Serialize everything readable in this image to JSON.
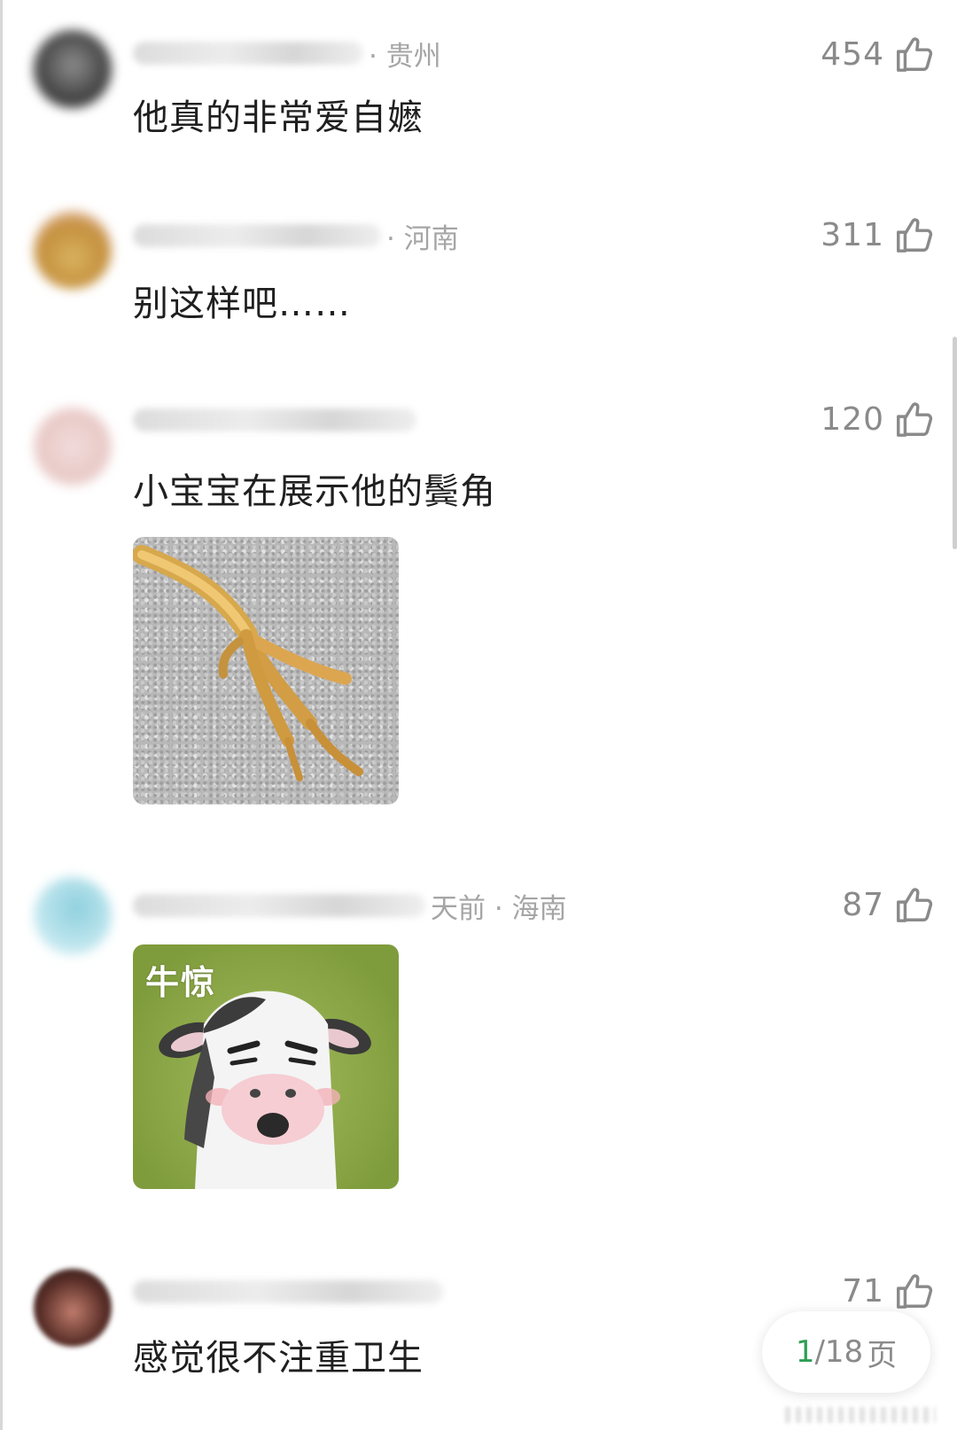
{
  "comments": [
    {
      "location": "· 贵州",
      "likes": "454",
      "text": "他真的非常爱自嬷"
    },
    {
      "location": "· 河南",
      "likes": "311",
      "text": "别这样吧……"
    },
    {
      "location": "",
      "likes": "120",
      "text": "小宝宝在展示他的鬓角",
      "image": "bird-claw-photo"
    },
    {
      "location": "天前 · 海南",
      "likes": "87",
      "text": "",
      "image": "cow-meme-sticker",
      "image_caption": "牛惊"
    },
    {
      "location": "",
      "likes": "71",
      "text": "感觉很不注重卫生"
    }
  ],
  "pager": {
    "current": "1",
    "separator": "/",
    "total": "18",
    "unit": "页"
  },
  "colors": {
    "background": "#ffffff",
    "text": "#1f1f1f",
    "meta": "#a5a5a5",
    "like_count": "#8a8a8a",
    "pager_current": "#2e9f55"
  },
  "icons": [
    "thumbs-up-icon"
  ]
}
